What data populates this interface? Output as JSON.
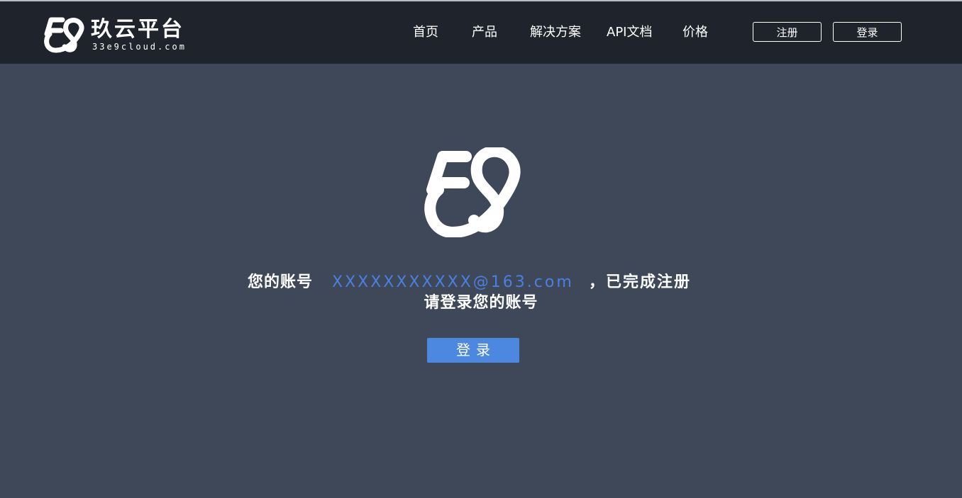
{
  "header": {
    "brand": {
      "name": "玖云平台",
      "domain": "33e9cloud.com"
    },
    "nav": {
      "home": "首页",
      "products": "产品",
      "solutions": "解决方案",
      "api_docs": "API文档",
      "pricing": "价格"
    },
    "actions": {
      "register": "注册",
      "login": "登录"
    }
  },
  "main": {
    "account_prefix": "您的账号",
    "email": "XXXXXXXXXXX@163.com",
    "account_suffix": "，已完成注册",
    "instruction": "请登录您的账号",
    "login_button": "登录"
  },
  "colors": {
    "header_bg": "#1f242c",
    "page_bg": "#3f4858",
    "email_text": "#4b7fe0",
    "primary_button": "#4d88e0"
  }
}
